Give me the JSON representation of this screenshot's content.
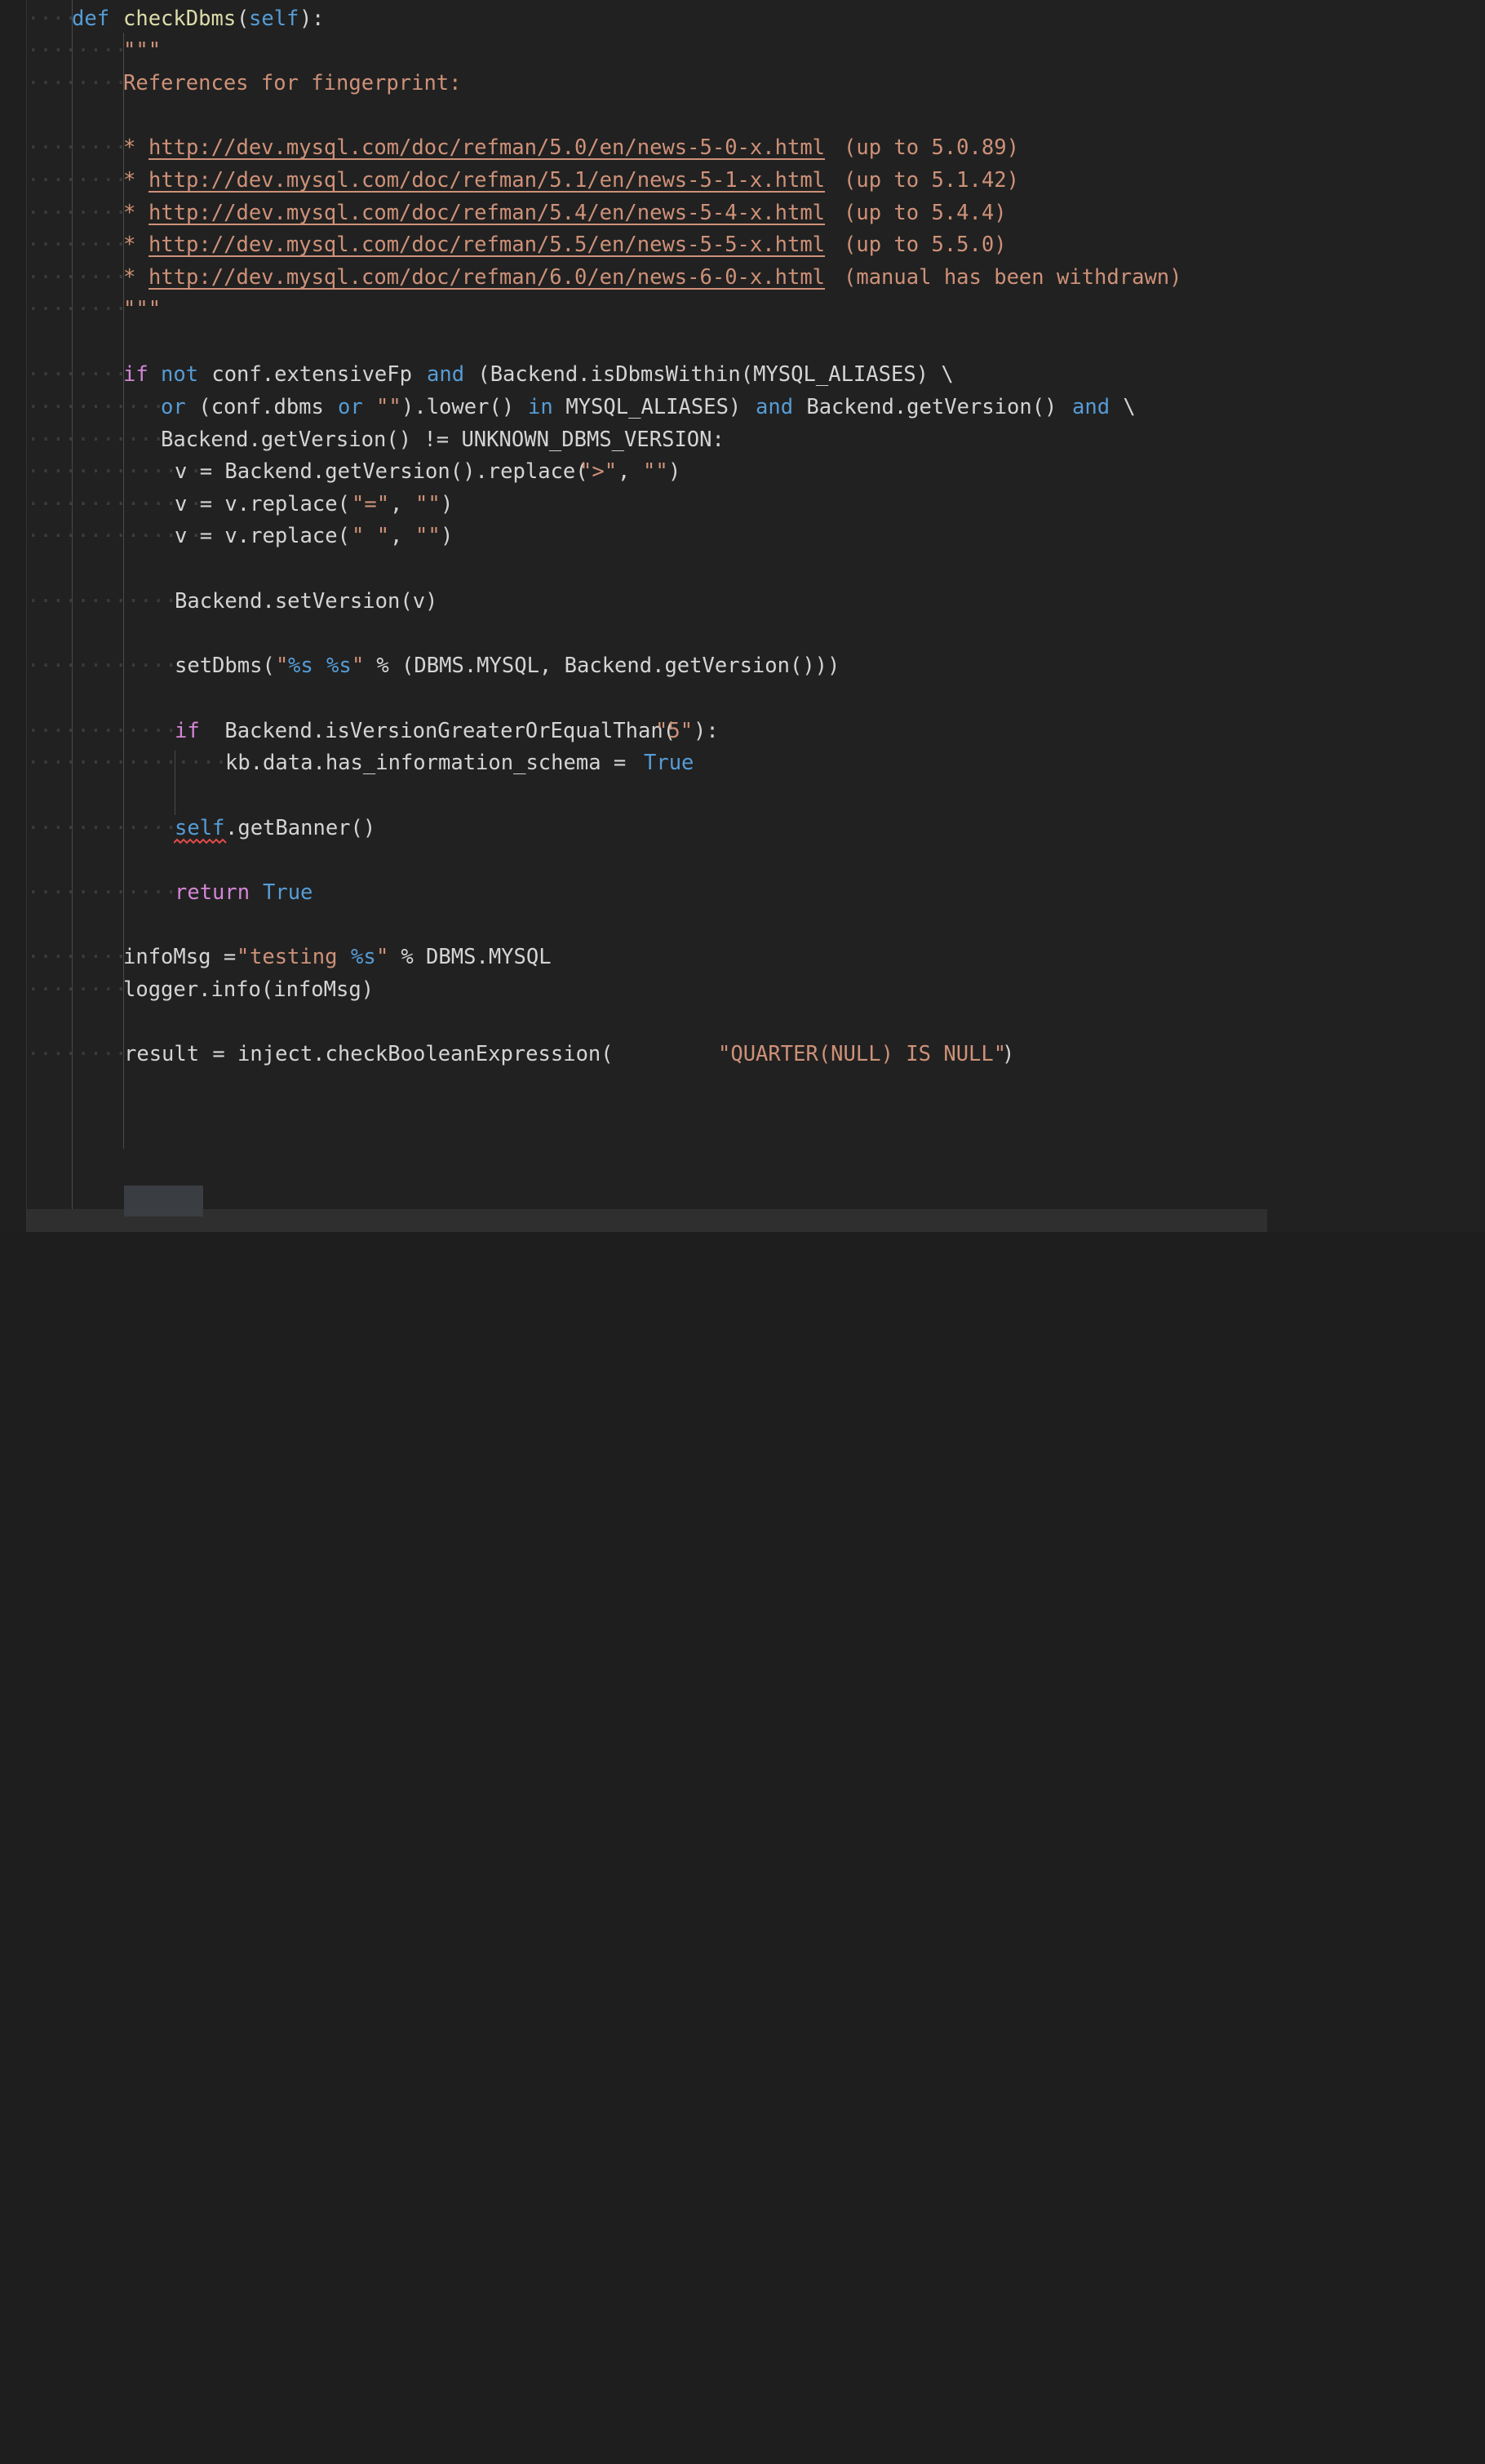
{
  "editor": {
    "language": "python",
    "theme": "dark",
    "background": "#212121",
    "gutter_background": "#1f1f1f",
    "indent_guide_color": "#4a4a4a",
    "whitespace_dot_color": "#3c3c3c",
    "colors": {
      "keyword": "#569cd6",
      "control_keyword": "#d486d6",
      "function_name": "#dcdcaa",
      "identifier": "#d4d4d4",
      "string": "#ce9178",
      "format_spec": "#569cd6",
      "link": "#ce9178",
      "error_squiggle": "#e24b4b",
      "word_highlight": "#3a3d41",
      "line_highlight": "#2f2f2f"
    }
  },
  "code": {
    "function_signature": {
      "def_keyword": "def",
      "name": "checkDbms",
      "param": "self",
      "open_paren": "(",
      "close_paren": ")",
      "colon": ":"
    },
    "docstring": {
      "delimiter": "\"\"\"",
      "heading": "References for fingerprint:",
      "bullet": "*",
      "references": [
        {
          "url": "http://dev.mysql.com/doc/refman/5.0/en/news-5-0-x.html",
          "note": "(up to 5.0.89)"
        },
        {
          "url": "http://dev.mysql.com/doc/refman/5.1/en/news-5-1-x.html",
          "note": "(up to 5.1.42)"
        },
        {
          "url": "http://dev.mysql.com/doc/refman/5.4/en/news-5-4-x.html",
          "note": "(up to 5.4.4)"
        },
        {
          "url": "http://dev.mysql.com/doc/refman/5.5/en/news-5-5-x.html",
          "note": "(up to 5.5.0)"
        },
        {
          "url": "http://dev.mysql.com/doc/refman/6.0/en/news-6-0-x.html",
          "note": "(manual has been withdrawn)"
        }
      ]
    },
    "statements": {
      "if_line_1": {
        "if": "if",
        "not": "not",
        "expr_a": " conf.extensiveFp ",
        "and": "and",
        "expr_b": " (Backend.isDbmsWithin(MYSQL_ALIASES) \\"
      },
      "if_line_2": {
        "or1": "or",
        "expr_a": " (conf.dbms ",
        "or2": "or",
        "str_empty": "\"\"",
        "expr_b": ").lower() ",
        "in": "in",
        "expr_c": " MYSQL_ALIASES) ",
        "and": "and",
        "expr_d": " Backend.getVersion() ",
        "and2": "and",
        "cont": " \\"
      },
      "if_line_3": "Backend.getVersion() != UNKNOWN_DBMS_VERSION:",
      "v_assign_1": {
        "lhs": "v = Backend.getVersion().replace(",
        "s1": "\">\"",
        "mid": ", ",
        "s2": "\"\"",
        "rhs": ")"
      },
      "v_assign_2": {
        "lhs": "v = v.replace(",
        "s1": "\"=\"",
        "mid": ", ",
        "s2": "\"\"",
        "rhs": ")"
      },
      "v_assign_3": {
        "lhs": "v = v.replace(",
        "s1": "\" \"",
        "mid": ", ",
        "s2": "\"\"",
        "rhs": ")"
      },
      "set_version": "Backend.setVersion(v)",
      "set_dbms": {
        "pre": "setDbms(",
        "q1": "\"",
        "f1": "%s",
        "space": " ",
        "f2": "%s",
        "q2": "\"",
        "post": " % (DBMS.MYSQL, Backend.getVersion()))"
      },
      "if_version": {
        "if": "if",
        "expr": " Backend.isVersionGreaterOrEqualThan(",
        "str": "\"5\"",
        "tail": "):"
      },
      "has_schema": {
        "lhs": "kb.data.has_information_schema = ",
        "value": "True"
      },
      "get_banner": {
        "self": "self",
        "rest": ".getBanner()"
      },
      "return_true": {
        "return": "return",
        "value": "True"
      },
      "info_msg": {
        "lhs": "infoMsg = ",
        "q1": "\"",
        "text": "testing ",
        "fmt": "%s",
        "q2": "\"",
        "rhs": " % DBMS.MYSQL"
      },
      "logger_info": "logger.info(infoMsg)",
      "result_line": {
        "word": "result",
        "mid": " = inject.checkBooleanExpression(",
        "str": "\"QUARTER(NULL) IS NULL\"",
        "tail": ")"
      }
    }
  }
}
